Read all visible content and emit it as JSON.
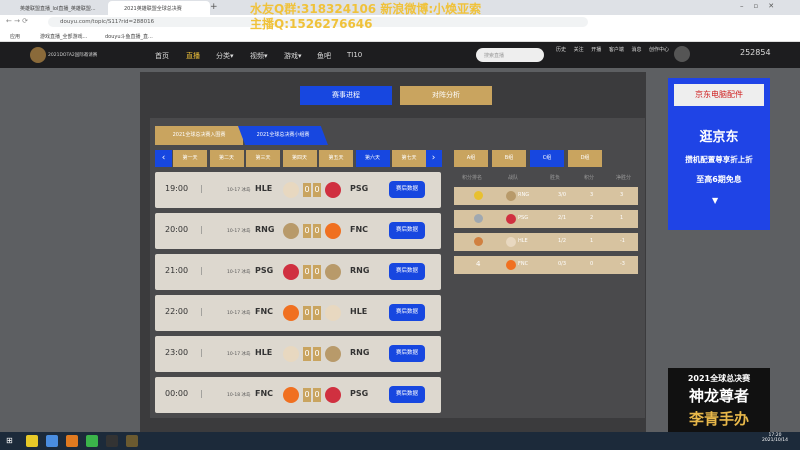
{
  "browser": {
    "tabs": [
      "英雄联盟直播_lol直播_英雄联盟...",
      "2021英雄联盟全球总决赛"
    ],
    "url": "douyu.com/topic/S11?rid=288016",
    "bookmarks": [
      "应用",
      "游戏直播_全部游戏...",
      "douyu斗鱼直播_直..."
    ]
  },
  "overlay": {
    "line1": "水友Q群:318324106 新浪微博:小焕亚索",
    "line2": "主播Q:1526276646"
  },
  "site_nav": {
    "logo_text": "2021DOTA2国际邀请赛",
    "items": [
      "首页",
      "直播",
      "分类▾",
      "视频▾",
      "游戏▾",
      "鱼吧",
      "TI10"
    ],
    "active": "直播",
    "search_placeholder": "搜索直播",
    "icons": [
      "历史",
      "关注",
      "开播",
      "客户端",
      "消息",
      "创作中心"
    ],
    "user_id": "252854"
  },
  "main": {
    "buttons": [
      "赛事进程",
      "对阵分析"
    ],
    "stage_tabs": [
      "2021全球总决赛入围赛",
      "2021全球总决赛小组赛"
    ],
    "days": [
      "第一天",
      "第二天",
      "第三天",
      "第四天",
      "第五天",
      "第六天",
      "第七天"
    ],
    "active_day": "第六天",
    "matches": [
      {
        "time": "19:00",
        "date": "10-17 冰岛",
        "team_a": "HLE",
        "score_a": "0",
        "score_b": "0",
        "team_b": "PSG",
        "btn": "赛后数据"
      },
      {
        "time": "20:00",
        "date": "10-17 冰岛",
        "team_a": "RNG",
        "score_a": "0",
        "score_b": "0",
        "team_b": "FNC",
        "btn": "赛后数据"
      },
      {
        "time": "21:00",
        "date": "10-17 冰岛",
        "team_a": "PSG",
        "score_a": "0",
        "score_b": "0",
        "team_b": "RNG",
        "btn": "赛后数据"
      },
      {
        "time": "22:00",
        "date": "10-17 冰岛",
        "team_a": "FNC",
        "score_a": "0",
        "score_b": "0",
        "team_b": "HLE",
        "btn": "赛后数据"
      },
      {
        "time": "23:00",
        "date": "10-17 冰岛",
        "team_a": "HLE",
        "score_a": "0",
        "score_b": "0",
        "team_b": "RNG",
        "btn": "赛后数据"
      },
      {
        "time": "00:00",
        "date": "10-18 冰岛",
        "team_a": "FNC",
        "score_a": "0",
        "score_b": "0",
        "team_b": "PSG",
        "btn": "赛后数据"
      }
    ],
    "groups": [
      "A组",
      "B组",
      "C组",
      "D组"
    ],
    "active_group": "C组",
    "standings_headers": [
      "积分排名",
      "战队",
      "胜负",
      "积分",
      "净胜分"
    ],
    "standings": [
      {
        "rank": "1",
        "team": "RNG",
        "wl": "3/0",
        "pts": "3",
        "net": "3"
      },
      {
        "rank": "2",
        "team": "PSG",
        "wl": "2/1",
        "pts": "2",
        "net": "1"
      },
      {
        "rank": "3",
        "team": "HLE",
        "wl": "1/2",
        "pts": "1",
        "net": "-1"
      },
      {
        "rank": "4",
        "team": "FNC",
        "wl": "0/3",
        "pts": "0",
        "net": "-3"
      }
    ]
  },
  "ads": {
    "jd": {
      "title": "京东电脑配件",
      "l1": "逛京东",
      "l2": "攒机配置尊享折上折",
      "l3": "至高6期免息"
    },
    "promo": {
      "l1": "2021全球总决赛",
      "l2": "神龙尊者",
      "l3": "李青手办"
    }
  },
  "taskbar": {
    "time": "17:20",
    "date": "2021/10/14"
  },
  "colors": {
    "blue": "#1747e0",
    "gold": "#c9a45f"
  }
}
